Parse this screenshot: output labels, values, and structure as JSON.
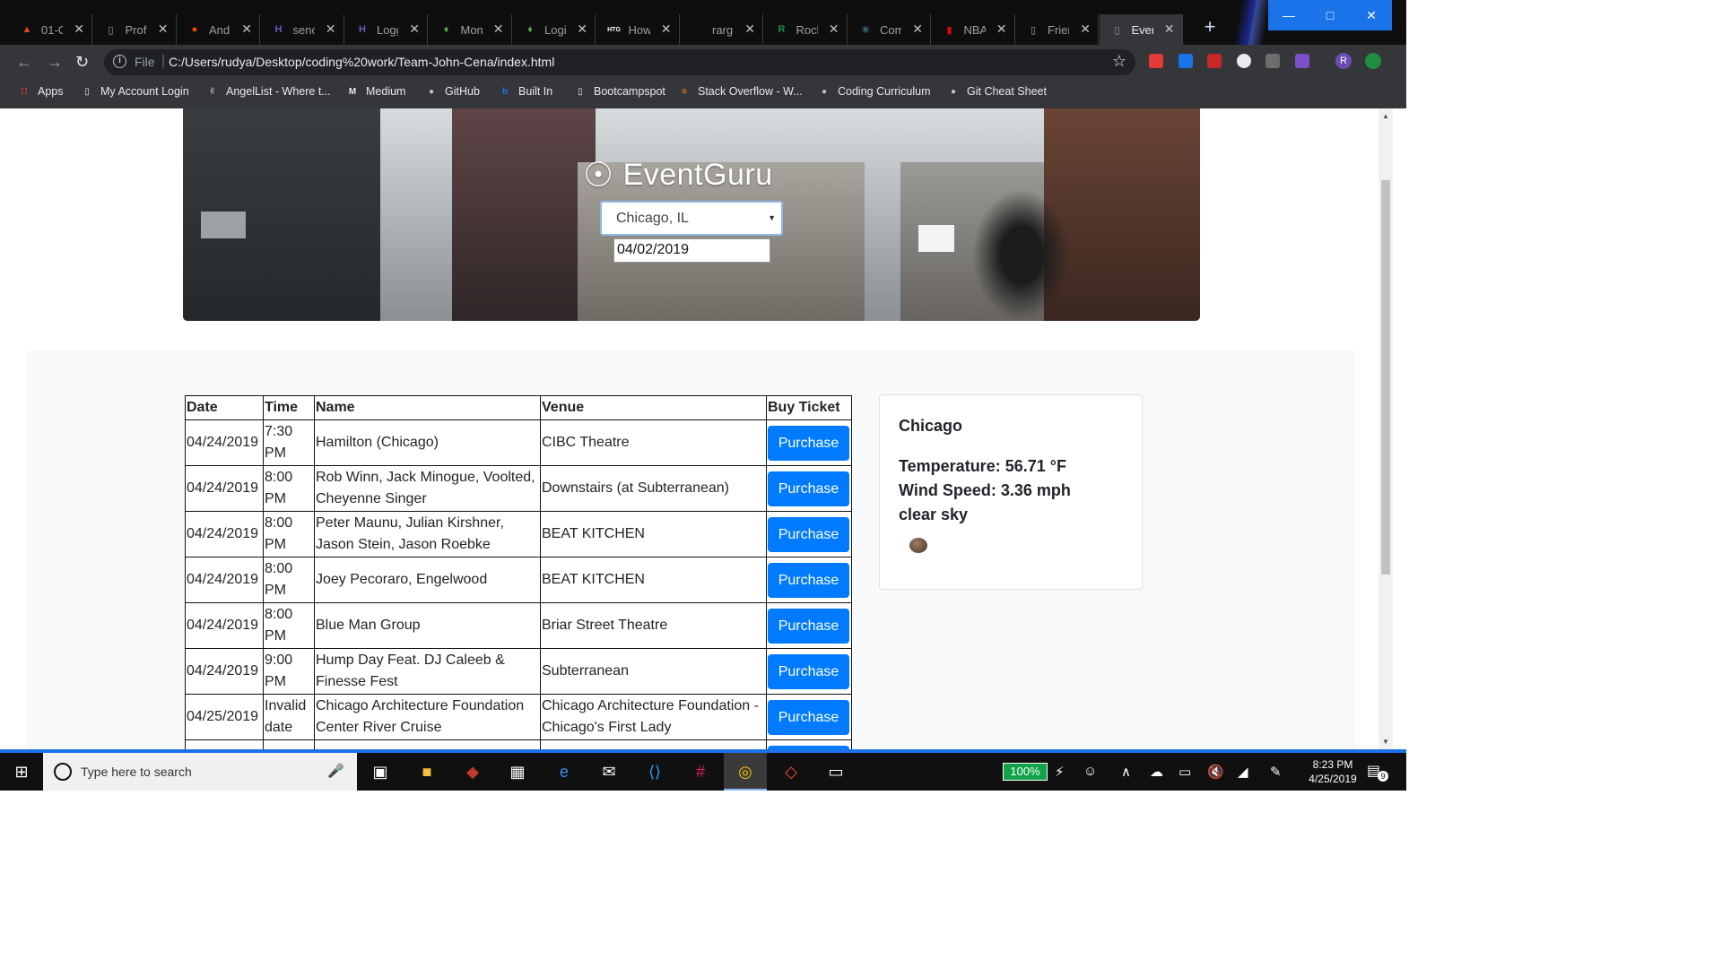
{
  "browser": {
    "tabs": [
      {
        "title": "01-Cl",
        "icon": "gitlab-icon",
        "color": "#e24329"
      },
      {
        "title": "Profe",
        "icon": "document-icon",
        "color": "#9aa0a6"
      },
      {
        "title": "Andr",
        "icon": "reddit-icon",
        "color": "#ff4500"
      },
      {
        "title": "senor",
        "icon": "heroku-icon",
        "color": "#7056bf"
      },
      {
        "title": "Logg",
        "icon": "heroku-icon",
        "color": "#7056bf"
      },
      {
        "title": "Mon",
        "icon": "mongodb-leaf-icon",
        "color": "#4fa94d"
      },
      {
        "title": "Login",
        "icon": "mongodb-leaf-icon",
        "color": "#4fa94d"
      },
      {
        "title": "How",
        "icon": "htg-icon",
        "color": "#ffffff"
      },
      {
        "title": "rargu",
        "icon": "github-icon",
        "color": "#111111"
      },
      {
        "title": "Rock",
        "icon": "rocket-icon",
        "color": "#1e8e3e"
      },
      {
        "title": "Comp",
        "icon": "react-icon",
        "color": "#61dafb"
      },
      {
        "title": "NBA",
        "icon": "nba-icon",
        "color": "#d50a0a"
      },
      {
        "title": "Frien",
        "icon": "document-icon",
        "color": "#9aa0a6"
      },
      {
        "title": "Event",
        "icon": "document-icon",
        "color": "#9aa0a6"
      }
    ],
    "address": {
      "scheme": "File",
      "url": "C:/Users/rudya/Desktop/coding%20work/Team-John-Cena/index.html"
    },
    "bookmarks": [
      {
        "label": "Apps",
        "icon": "apps-grid-icon"
      },
      {
        "label": "My Account Login",
        "icon": "document-icon"
      },
      {
        "label": "AngelList - Where t...",
        "icon": "angellist-icon"
      },
      {
        "label": "Medium",
        "icon": "medium-icon"
      },
      {
        "label": "GitHub",
        "icon": "github-icon"
      },
      {
        "label": "Built In",
        "icon": "builtin-icon"
      },
      {
        "label": "Bootcampspot",
        "icon": "document-icon"
      },
      {
        "label": "Stack Overflow - W...",
        "icon": "stackoverflow-icon"
      },
      {
        "label": "Coding Curriculum",
        "icon": "github-icon"
      },
      {
        "label": "Git Cheat Sheet",
        "icon": "github-icon"
      }
    ],
    "profile_initial": "R"
  },
  "page": {
    "brand": "EventGuru",
    "city_select": "Chicago, IL",
    "date_input": "04/02/2019",
    "table": {
      "headers": [
        "Date",
        "Time",
        "Name",
        "Venue",
        "Buy Ticket"
      ],
      "buy_label": "Purchase",
      "rows": [
        {
          "date": "04/24/2019",
          "time": "7:30 PM",
          "name": "Hamilton (Chicago)",
          "venue": "CIBC Theatre"
        },
        {
          "date": "04/24/2019",
          "time": "8:00 PM",
          "name": "Rob Winn, Jack Minogue, Voolted, Cheyenne Singer",
          "venue": "Downstairs (at Subterranean)"
        },
        {
          "date": "04/24/2019",
          "time": "8:00 PM",
          "name": "Peter Maunu, Julian Kirshner, Jason Stein, Jason Roebke",
          "venue": "BEAT KITCHEN"
        },
        {
          "date": "04/24/2019",
          "time": "8:00 PM",
          "name": "Joey Pecoraro, Engelwood",
          "venue": "BEAT KITCHEN"
        },
        {
          "date": "04/24/2019",
          "time": "8:00 PM",
          "name": "Blue Man Group",
          "venue": "Briar Street Theatre"
        },
        {
          "date": "04/24/2019",
          "time": "9:00 PM",
          "name": "Hump Day Feat. DJ Caleeb & Finesse Fest",
          "venue": "Subterranean"
        },
        {
          "date": "04/25/2019",
          "time": "Invalid date",
          "name": "Chicago Architecture Foundation Center River Cruise",
          "venue": "Chicago Architecture Foundation - Chicago's First Lady"
        }
      ]
    },
    "weather": {
      "city": "Chicago",
      "temperature": "Temperature: 56.71 °F",
      "wind": "Wind Speed: 3.36 mph",
      "description": "clear sky",
      "icon": "clear-sky-weather-icon"
    }
  },
  "taskbar": {
    "search_placeholder": "Type here to search",
    "battery": "100%",
    "time": "8:23 PM",
    "date": "4/25/2019",
    "notifications": "9"
  },
  "colors": {
    "accent": "#007bff",
    "windows_blue": "#1a73e8",
    "chrome_dark": "#35363a"
  }
}
